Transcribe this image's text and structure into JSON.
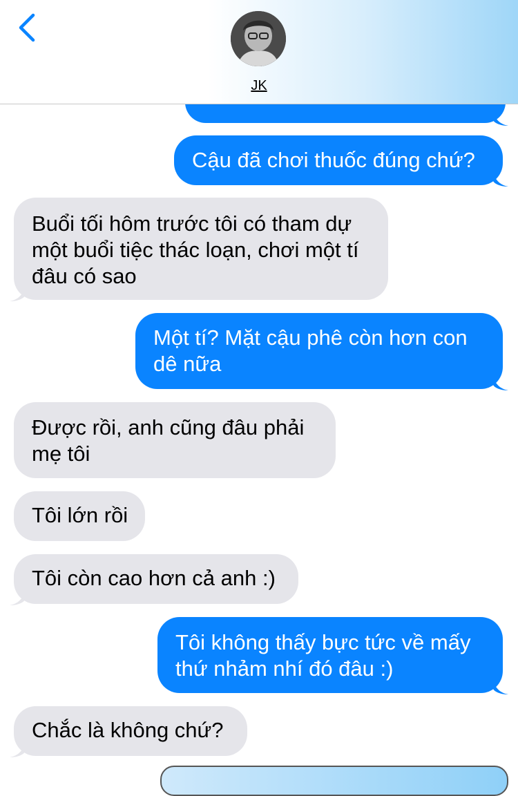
{
  "header": {
    "contact_name": "JK",
    "back_icon": "chevron-left-icon",
    "avatar": "contact-avatar"
  },
  "colors": {
    "incoming_bubble": "#e5e5ea",
    "outgoing_bubble": "#0a84ff",
    "accent": "#0a84ff"
  },
  "messages": [
    {
      "direction": "out",
      "text": "",
      "partial": true
    },
    {
      "direction": "out",
      "text": "Cậu đã chơi thuốc đúng chứ?"
    },
    {
      "direction": "in",
      "text": "Buổi tối hôm trước tôi có tham dự một buổi tiệc thác loạn, chơi một tí đâu có sao"
    },
    {
      "direction": "out",
      "text": "Một tí? Mặt cậu phê còn hơn con dê nữa"
    },
    {
      "direction": "in",
      "text": "Được rồi, anh cũng đâu phải mẹ tôi"
    },
    {
      "direction": "in",
      "text": "Tôi lớn rồi"
    },
    {
      "direction": "in",
      "text": "Tôi còn cao hơn cả anh :)"
    },
    {
      "direction": "out",
      "text": "Tôi không thấy bực tức về mấy thứ nhảm nhí đó đâu :)"
    },
    {
      "direction": "in",
      "text": "Chắc là không chứ?"
    }
  ]
}
